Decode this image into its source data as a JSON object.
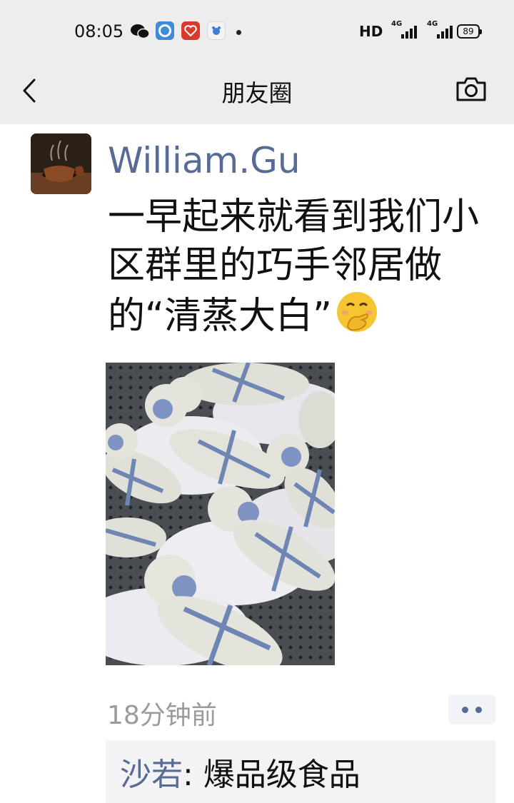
{
  "status_bar": {
    "time": "08:05",
    "icons": [
      "wechat-icon",
      "app-icon",
      "app-icon",
      "app-icon",
      "dot-icon"
    ],
    "hd_label": "HD",
    "signal_label_1": "4G",
    "signal_label_2": "4G",
    "battery_level": "89"
  },
  "nav": {
    "title": "朋友圈",
    "back_icon": "back-chevron-icon",
    "camera_icon": "camera-icon"
  },
  "post": {
    "author": "William.Gu",
    "text": "一早起来就看到我们小区群里的巧手邻居做的“清蒸大白”",
    "emoji": "face-with-hand-over-mouth-emoji",
    "timestamp": "18分钟前",
    "comments": [
      {
        "name": "沙若",
        "separator": ": ",
        "text": "爆品级食品"
      }
    ]
  },
  "colors": {
    "link": "#576b95",
    "header_bg": "#ededed",
    "timestamp": "#9b9b9b"
  }
}
